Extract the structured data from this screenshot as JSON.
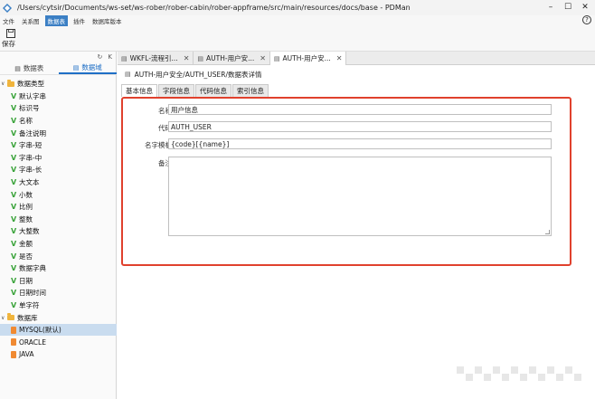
{
  "window": {
    "title": "/Users/cytsir/Documents/ws-set/ws-rober/rober-cabin/rober-appframe/src/main/resources/docs/base - PDMan"
  },
  "menu": {
    "items": [
      "文件",
      "关系图",
      "数据表",
      "插件",
      "数据库版本"
    ],
    "active_index": 2
  },
  "toolbar": {
    "save_label": "保存"
  },
  "left_panel": {
    "tabs": [
      "数据表",
      "数据域"
    ],
    "active_tab": 1,
    "tree": [
      {
        "type": "group",
        "label": "数据类型"
      },
      {
        "type": "leaf",
        "label": "默认字串"
      },
      {
        "type": "leaf",
        "label": "标识号"
      },
      {
        "type": "leaf",
        "label": "名称"
      },
      {
        "type": "leaf",
        "label": "备注说明"
      },
      {
        "type": "leaf",
        "label": "字串-短"
      },
      {
        "type": "leaf",
        "label": "字串-中"
      },
      {
        "type": "leaf",
        "label": "字串-长"
      },
      {
        "type": "leaf",
        "label": "大文本"
      },
      {
        "type": "leaf",
        "label": "小数"
      },
      {
        "type": "leaf",
        "label": "比例"
      },
      {
        "type": "leaf",
        "label": "整数"
      },
      {
        "type": "leaf",
        "label": "大整数"
      },
      {
        "type": "leaf",
        "label": "金额"
      },
      {
        "type": "leaf",
        "label": "是否"
      },
      {
        "type": "leaf",
        "label": "数据字典"
      },
      {
        "type": "leaf",
        "label": "日期"
      },
      {
        "type": "leaf",
        "label": "日期时间"
      },
      {
        "type": "leaf",
        "label": "单字符"
      },
      {
        "type": "group",
        "label": "数据库"
      },
      {
        "type": "db",
        "label": "MYSQL(默认)"
      },
      {
        "type": "db",
        "label": "ORACLE"
      },
      {
        "type": "db",
        "label": "JAVA"
      }
    ],
    "selected_index": 20
  },
  "doc_tabs": [
    {
      "label": "WKFL-流程引..."
    },
    {
      "label": "AUTH-用户安..."
    },
    {
      "label": "AUTH-用户安..."
    }
  ],
  "doc_tabs_active": 2,
  "doc_header": "AUTH-用户安全/AUTH_USER/数据表详情",
  "sub_tabs": [
    "基本信息",
    "字段信息",
    "代码信息",
    "索引信息"
  ],
  "form": {
    "name_label": "名称",
    "name_value": "用户信息",
    "code_label": "代码",
    "code_value": "AUTH_USER",
    "template_label": "名字模板",
    "template_value": "{code}[{name}]",
    "remark_label": "备注",
    "remark_value": ""
  },
  "colors": {
    "accent": "#1f6fc6",
    "highlight_border": "#e0412d",
    "selected_row": "#c9dcef"
  }
}
